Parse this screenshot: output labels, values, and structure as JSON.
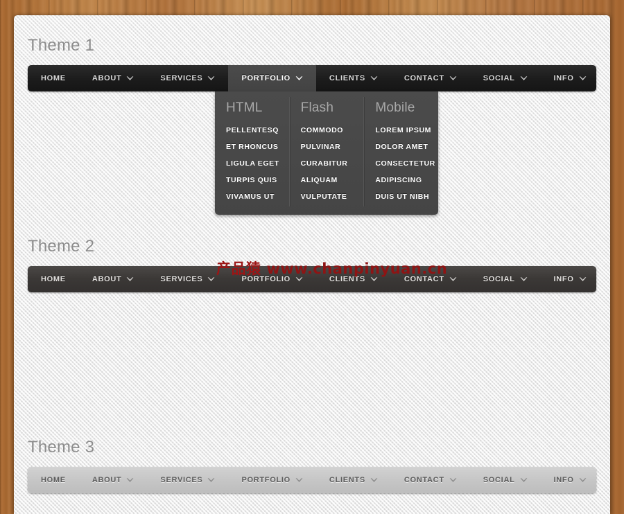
{
  "watermark": {
    "brand": "产品猿",
    "url": "www.chanpinyuan.cn"
  },
  "nav_items": {
    "home": "HOME",
    "about": "ABOUT",
    "services": "SERVICES",
    "portfolio": "PORTFOLIO",
    "clients": "CLIENTS",
    "contact": "CONTACT",
    "social": "SOCIAL",
    "info": "INFO"
  },
  "themes": [
    {
      "title": "Theme 1",
      "style": "dark",
      "active_item": "PORTFOLIO",
      "left_items": [
        {
          "label": "HOME",
          "caret": false
        },
        {
          "label": "ABOUT",
          "caret": true
        },
        {
          "label": "SERVICES",
          "caret": true
        },
        {
          "label": "PORTFOLIO",
          "caret": true
        },
        {
          "label": "CLIENTS",
          "caret": true
        },
        {
          "label": "CONTACT",
          "caret": true
        }
      ],
      "right_items": [
        {
          "label": "SOCIAL",
          "caret": true
        },
        {
          "label": "INFO",
          "caret": true
        }
      ],
      "dropdown": {
        "open": true,
        "columns": [
          {
            "heading": "HTML",
            "items": [
              "PELLENTESQ",
              "ET RHONCUS",
              "LIGULA EGET",
              "TURPIS QUIS",
              "VIVAMUS UT"
            ]
          },
          {
            "heading": "Flash",
            "items": [
              "COMMODO",
              "PULVINAR",
              "CURABITUR",
              "ALIQUAM",
              "VULPUTATE"
            ]
          },
          {
            "heading": "Mobile",
            "items": [
              "LOREM IPSUM",
              "DOLOR AMET",
              "CONSECTETUR",
              "ADIPISCING",
              "DUIS UT NIBH"
            ]
          }
        ]
      }
    },
    {
      "title": "Theme 2",
      "style": "greydark",
      "active_item": "",
      "left_items": [
        {
          "label": "HOME",
          "caret": false
        },
        {
          "label": "ABOUT",
          "caret": true
        },
        {
          "label": "SERVICES",
          "caret": true
        },
        {
          "label": "PORTFOLIO",
          "caret": true
        },
        {
          "label": "CLIENTS",
          "caret": true
        },
        {
          "label": "CONTACT",
          "caret": true
        }
      ],
      "right_items": [
        {
          "label": "SOCIAL",
          "caret": true
        },
        {
          "label": "INFO",
          "caret": true
        }
      ],
      "dropdown": {
        "open": false,
        "columns": []
      }
    },
    {
      "title": "Theme 3",
      "style": "light",
      "active_item": "",
      "left_items": [
        {
          "label": "HOME",
          "caret": false
        },
        {
          "label": "ABOUT",
          "caret": true
        },
        {
          "label": "SERVICES",
          "caret": true
        },
        {
          "label": "PORTFOLIO",
          "caret": true
        },
        {
          "label": "CLIENTS",
          "caret": true
        },
        {
          "label": "CONTACT",
          "caret": true
        }
      ],
      "right_items": [
        {
          "label": "SOCIAL",
          "caret": true
        },
        {
          "label": "INFO",
          "caret": true
        }
      ],
      "dropdown": {
        "open": false,
        "columns": []
      }
    }
  ],
  "colors": {
    "wood": "#b5763f",
    "sheet": "#eeeeee",
    "nav_dark": "#1c1c1c",
    "nav_greydark": "#3b3836",
    "nav_light": "#c6c6c6",
    "dropdown": "#454545",
    "title_text": "#8c8c8c",
    "watermark": "#9c1515"
  }
}
